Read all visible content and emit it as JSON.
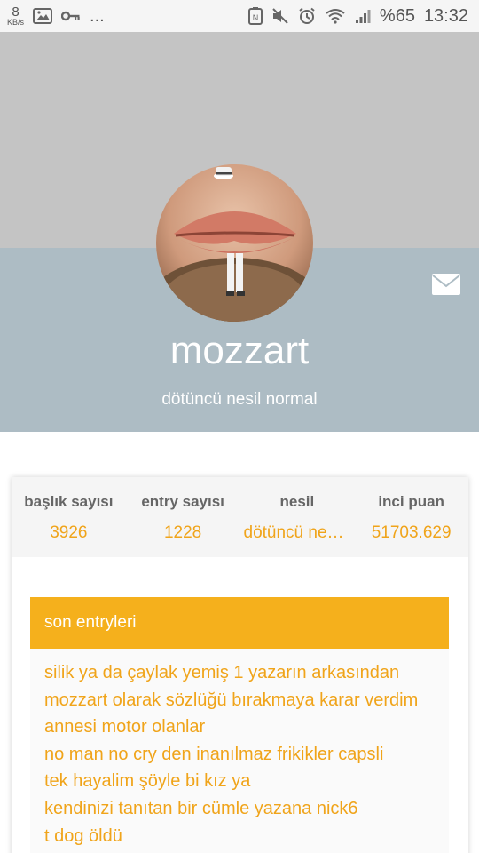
{
  "status_bar": {
    "speed_value": "8",
    "speed_unit": "KB/s",
    "more": "...",
    "battery": "%65",
    "time": "13:32",
    "icons_left": [
      "image-icon",
      "key-icon"
    ],
    "icons_right": [
      "nfc-icon",
      "mute-icon",
      "alarm-icon",
      "wifi-icon",
      "signal-icon"
    ]
  },
  "profile": {
    "username": "mozzart",
    "generation_title": "dötüncü nesil normal"
  },
  "stats": [
    {
      "label": "başlık sayısı",
      "value": "3926"
    },
    {
      "label": "entry sayısı",
      "value": "1228"
    },
    {
      "label": "nesil",
      "value": "dötüncü nesil normal"
    },
    {
      "label": "inci puan",
      "value": "51703.629"
    }
  ],
  "recent": {
    "title": "son entryleri",
    "entries": [
      "silik ya da çaylak yemiş 1 yazarın arkasından",
      "mozzart olarak sözlüğü bırakmaya karar verdim",
      "annesi motor olanlar",
      "no man no cry den inanılmaz frikikler capsli",
      "tek hayalim şöyle bi kız ya",
      "kendinizi tanıtan bir cümle yazana nick6",
      "t dog öldü"
    ]
  },
  "colors": {
    "header_top": "#c4c4c4",
    "header_bottom": "#adbcc4",
    "accent": "#f5b01c",
    "accent_text": "#f0a41a"
  }
}
